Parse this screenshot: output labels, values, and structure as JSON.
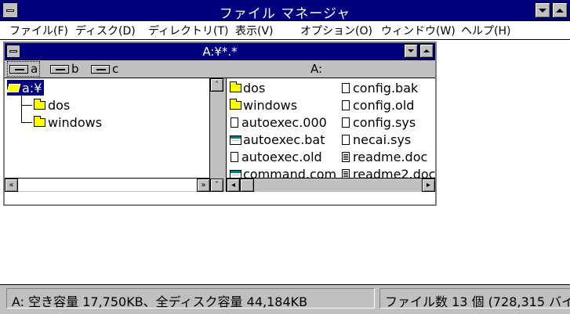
{
  "window": {
    "title": "ファイル マネージャ"
  },
  "menu": [
    {
      "label": "ファイル(F)"
    },
    {
      "label": "ディスク(D)"
    },
    {
      "label": "ディレクトリ(T)"
    },
    {
      "label": "表示(V)"
    },
    {
      "label": "オプション(O)"
    },
    {
      "label": "ウィンドウ(W)"
    },
    {
      "label": "ヘルプ(H)"
    }
  ],
  "child_window": {
    "title": "A:¥*.*",
    "drives": [
      {
        "letter": "a",
        "selected": true
      },
      {
        "letter": "b",
        "selected": false
      },
      {
        "letter": "c",
        "selected": false
      }
    ],
    "current_drive_label": "A:"
  },
  "tree": {
    "root": "a:¥",
    "children": [
      "dos",
      "windows"
    ]
  },
  "files": [
    {
      "name": "dos",
      "icon": "folder-icon"
    },
    {
      "name": "windows",
      "icon": "folder-icon"
    },
    {
      "name": "autoexec.000",
      "icon": "file-icon"
    },
    {
      "name": "autoexec.bat",
      "icon": "program-icon"
    },
    {
      "name": "autoexec.old",
      "icon": "file-icon"
    },
    {
      "name": "command.com",
      "icon": "program-icon"
    },
    {
      "name": "config.bak",
      "icon": "file-icon"
    },
    {
      "name": "config.old",
      "icon": "file-icon"
    },
    {
      "name": "config.sys",
      "icon": "file-icon"
    },
    {
      "name": "necai.sys",
      "icon": "file-icon"
    },
    {
      "name": "readme.doc",
      "icon": "document-icon"
    },
    {
      "name": "readme2.doc",
      "icon": "document-icon"
    }
  ],
  "status": {
    "left": "A: 空き容量 17,750KB、全ディスク容量 44,184KB",
    "right": "ファイル数 13 個 (728,315 バイ"
  },
  "colors": {
    "titlebar": "#00007f",
    "chrome": "#c0c0c0",
    "selection": "#00007f",
    "folder": "#ffff00"
  }
}
